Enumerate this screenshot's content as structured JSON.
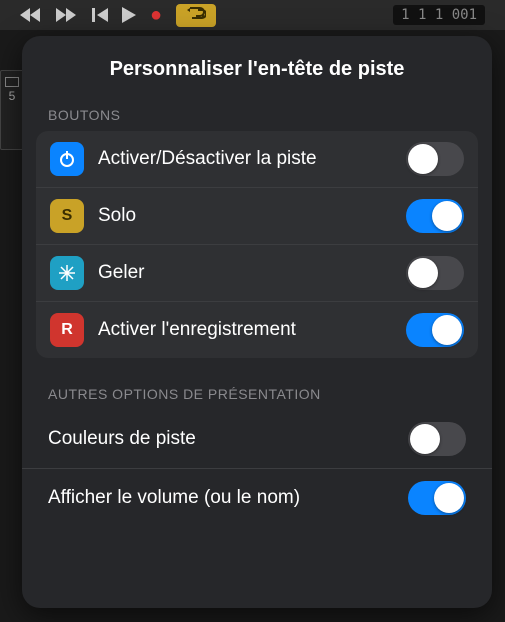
{
  "toolbar": {
    "counter": "1 1 1 001"
  },
  "popover": {
    "title": "Personnaliser l'en-tête de piste",
    "sections": {
      "buttons": {
        "header": "BOUTONS",
        "items": [
          {
            "label": "Activer/Désactiver la piste",
            "on": false
          },
          {
            "label": "Solo",
            "on": true
          },
          {
            "label": "Geler",
            "on": false
          },
          {
            "label": "Activer l'enregistrement",
            "on": true
          }
        ]
      },
      "display": {
        "header": "AUTRES OPTIONS DE PRÉSENTATION",
        "items": [
          {
            "label": "Couleurs de piste",
            "on": false
          },
          {
            "label": "Afficher le volume (ou le nom)",
            "on": true
          }
        ]
      }
    }
  },
  "icon_letters": {
    "solo": "S",
    "record": "R"
  }
}
